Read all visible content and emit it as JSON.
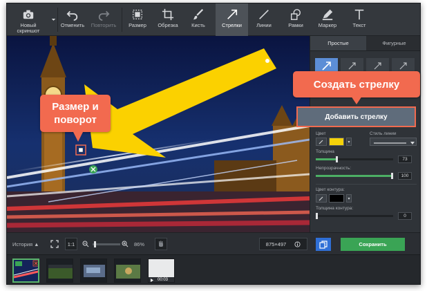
{
  "toolbar": {
    "new_screenshot": "Новый\nскриншот",
    "undo": "Отменить",
    "redo": "Повторить",
    "size": "Размер",
    "crop": "Обрезка",
    "brush": "Кисть",
    "arrows": "Стрелки",
    "lines": "Линии",
    "frames": "Рамки",
    "marker": "Маркер",
    "text": "Текст"
  },
  "panel": {
    "tabs": [
      "Простые",
      "Фигурные"
    ],
    "color_label": "Цвет",
    "style_label": "Стиль линии",
    "thickness_label": "Толщина",
    "thickness_value": "73",
    "opacity_label": "Непрозрачность:",
    "opacity_value": "100",
    "outline_color_label": "Цвет контура:",
    "outline_thickness_label": "Толщина контура:",
    "outline_thickness_value": "0",
    "arrow_color": "#f5d20a",
    "outline_color": "#000000"
  },
  "bottombar": {
    "history": "История ▲",
    "ratio": "1:1",
    "zoom": "86%",
    "dimensions": "875×497",
    "save": "Сохранить"
  },
  "callouts": {
    "size_rotate": "Размер и\nповорот",
    "create_arrow": "Создать стрелку",
    "add_arrow": "Добавить стрелку"
  },
  "history": {
    "last_duration": "00:03"
  },
  "colors": {
    "accent_green": "#3aa455",
    "callout": "#f26a4f",
    "arrow_yellow": "#fbd100"
  }
}
